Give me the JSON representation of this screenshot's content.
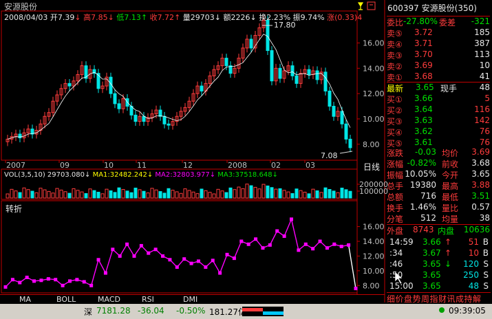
{
  "header": {
    "stock_name": "安源股份",
    "date": "2008/04/03",
    "open_label": "开",
    "open": "7.39",
    "open_arrow": "↓",
    "high_label": "高",
    "high": "7.85",
    "high_arrow": "↓",
    "low_label": "低",
    "low": "7.13",
    "low_arrow": "↑",
    "close_label": "收",
    "close": "7.72",
    "close_arrow": "↑",
    "vol_label": "量",
    "vol": "29703",
    "vol_arrow": "↓",
    "amt_label": "额",
    "amt": "2226",
    "amt_arrow": "↓",
    "turn_label": "换",
    "turn": "2.23%",
    "amp_label": "振",
    "amp": "9.74%",
    "chg_label": "涨",
    "chg": "(0.33)",
    "chg_value": "4"
  },
  "chart_data": [
    {
      "type": "candlestick",
      "title": "安源股份",
      "y_ticks": [
        "16.00",
        "14.00",
        "12.00",
        "10.00",
        "8.00"
      ],
      "ylim": [
        6.9,
        18.2
      ],
      "x_ticks": [
        "2007",
        "09",
        "10",
        "11",
        "12",
        "2008",
        "02",
        "03"
      ],
      "annotations": {
        "max": "17.80",
        "min": "7.08"
      },
      "close_series": [
        8.4,
        8.6,
        8.8,
        8.5,
        8.9,
        9.2,
        8.8,
        9.1,
        9.6,
        10.2,
        10.5,
        11.4,
        11.9,
        12.4,
        12.8,
        12.6,
        13.0,
        13.5,
        14.2,
        13.2,
        13.9,
        13.6,
        12.4,
        12.6,
        13.3,
        12.0,
        11.2,
        10.8,
        11.6,
        11.0,
        10.3,
        9.8,
        10.2,
        9.8,
        10.1,
        10.4,
        10.7,
        10.2,
        9.6,
        9.5,
        9.8,
        10.2,
        10.6,
        10.9,
        11.4,
        12.0,
        12.6,
        12.2,
        12.8,
        13.4,
        13.9,
        14.2,
        14.8,
        14.2,
        13.6,
        14.0,
        14.8,
        15.6,
        16.3,
        15.6,
        16.6,
        17.2,
        17.8,
        15.4,
        13.0,
        14.0,
        13.2,
        13.8,
        14.2,
        13.4,
        12.8,
        13.6,
        13.9,
        13.5,
        13.8,
        13.1,
        13.7,
        12.2,
        11.0,
        10.2,
        10.6,
        9.6,
        8.4,
        7.72
      ]
    },
    {
      "type": "bar",
      "title": "VOL(3,5,10)",
      "value": "29703.080",
      "value_arrow": "↓",
      "ma1_label": "MA1:32482.242",
      "ma1_arrow": "↓",
      "ma2_label": "MA2:32803.977",
      "ma2_arrow": "↓",
      "ma3_label": "MA3:37518.648",
      "ma3_arrow": "↓",
      "y_ticks": [
        "200000",
        "100000"
      ],
      "ylim": [
        0,
        260000
      ]
    },
    {
      "type": "line",
      "title": "转折",
      "y_ticks": [
        "16.00",
        "14.00",
        "12.00",
        "10.00",
        "8.00"
      ],
      "ylim": [
        7.0,
        18.2
      ],
      "points": [
        7.8,
        8.8,
        8.4,
        9.1,
        8.6,
        8.7,
        8.9,
        8.8,
        8.0,
        8.6,
        8.8,
        8.5,
        8.0,
        11.5,
        9.7,
        12.9,
        12.0,
        13.6,
        12.0,
        13.4,
        12.4,
        12.9,
        12.0,
        11.5,
        10.5,
        11.6,
        11.0,
        11.3,
        10.5,
        11.4,
        9.7,
        12.2,
        11.7,
        14.0,
        13.6,
        14.3,
        13.1,
        13.5,
        15.4,
        14.7,
        17.0,
        12.8,
        13.6,
        13.0,
        14.0,
        13.1,
        13.6,
        13.3,
        13.5,
        7.6
      ]
    }
  ],
  "x_axis_tag": "日线",
  "tabs": [
    "MA",
    "BOLL",
    "MACD",
    "RSI",
    "DMI"
  ],
  "right_panel": {
    "code": "600397",
    "name": "安源股份",
    "num": "(350)",
    "webi_label": "委比",
    "webi": "-27.80%",
    "weicha_label": "委差",
    "weicha": "-321",
    "asks": [
      {
        "label": "卖⑤",
        "price": "3.72",
        "vol": "185"
      },
      {
        "label": "卖④",
        "price": "3.71",
        "vol": "387"
      },
      {
        "label": "卖③",
        "price": "3.70",
        "vol": "113"
      },
      {
        "label": "卖②",
        "price": "3.69",
        "vol": "10"
      },
      {
        "label": "卖①",
        "price": "3.68",
        "vol": "41"
      }
    ],
    "last_label": "最新",
    "last": "3.65",
    "now_label": "现手",
    "now": "48",
    "bids": [
      {
        "label": "买①",
        "price": "3.66",
        "vol": "5"
      },
      {
        "label": "买②",
        "price": "3.64",
        "vol": "116"
      },
      {
        "label": "买③",
        "price": "3.63",
        "vol": "142"
      },
      {
        "label": "买④",
        "price": "3.62",
        "vol": "76"
      },
      {
        "label": "买⑤",
        "price": "3.61",
        "vol": "76"
      }
    ],
    "stats": [
      {
        "l1": "涨跌",
        "v1": "-0.03",
        "l2": "均价",
        "v2": "3.69"
      },
      {
        "l1": "涨幅",
        "v1": "-0.82%",
        "l2": "前收",
        "v2": "3.68"
      },
      {
        "l1": "振幅",
        "v1": "10.05%",
        "l2": "今开",
        "v2": "3.65"
      },
      {
        "l1": "总手",
        "v1": "19380",
        "l2": "最高",
        "v2": "3.88"
      },
      {
        "l1": "总额",
        "v1": "716",
        "l2": "最低",
        "v2": "3.51"
      },
      {
        "l1": "换手",
        "v1": "1.46%",
        "l2": "量比",
        "v2": "0.57"
      },
      {
        "l1": "分笔",
        "v1": "512",
        "l2": "均量",
        "v2": "38"
      }
    ],
    "outer_label": "外盘",
    "outer": "8743",
    "inner_label": "内盘",
    "inner": "10636",
    "ticks": [
      {
        "t": "14:59",
        "p": "3.66",
        "a": "↑",
        "v": "51",
        "s": "B"
      },
      {
        "t": ":34",
        "p": "3.67",
        "a": "↑",
        "v": "10",
        "s": "B"
      },
      {
        "t": ":46",
        "p": "3.65",
        "a": "↓",
        "v": "120",
        "s": "S"
      },
      {
        "t": ":50",
        "p": "3.65",
        "a": "",
        "v": "250",
        "s": "S"
      },
      {
        "t": "15:00",
        "p": "3.65",
        "a": "",
        "v": "48",
        "s": "S"
      }
    ],
    "bottom_tabs": "细价盘势周指财讯成持解"
  },
  "status": {
    "market": "深",
    "index": "7181.28",
    "change": "-36.04",
    "pct": "-0.50%",
    "amount": "181.27亿",
    "time": "09:39:05"
  },
  "colors": {
    "up": "#ff3c3c",
    "down": "#00e6e6",
    "line": "#ff00ff",
    "ma": "#ffffff",
    "axis": "#c00000"
  }
}
